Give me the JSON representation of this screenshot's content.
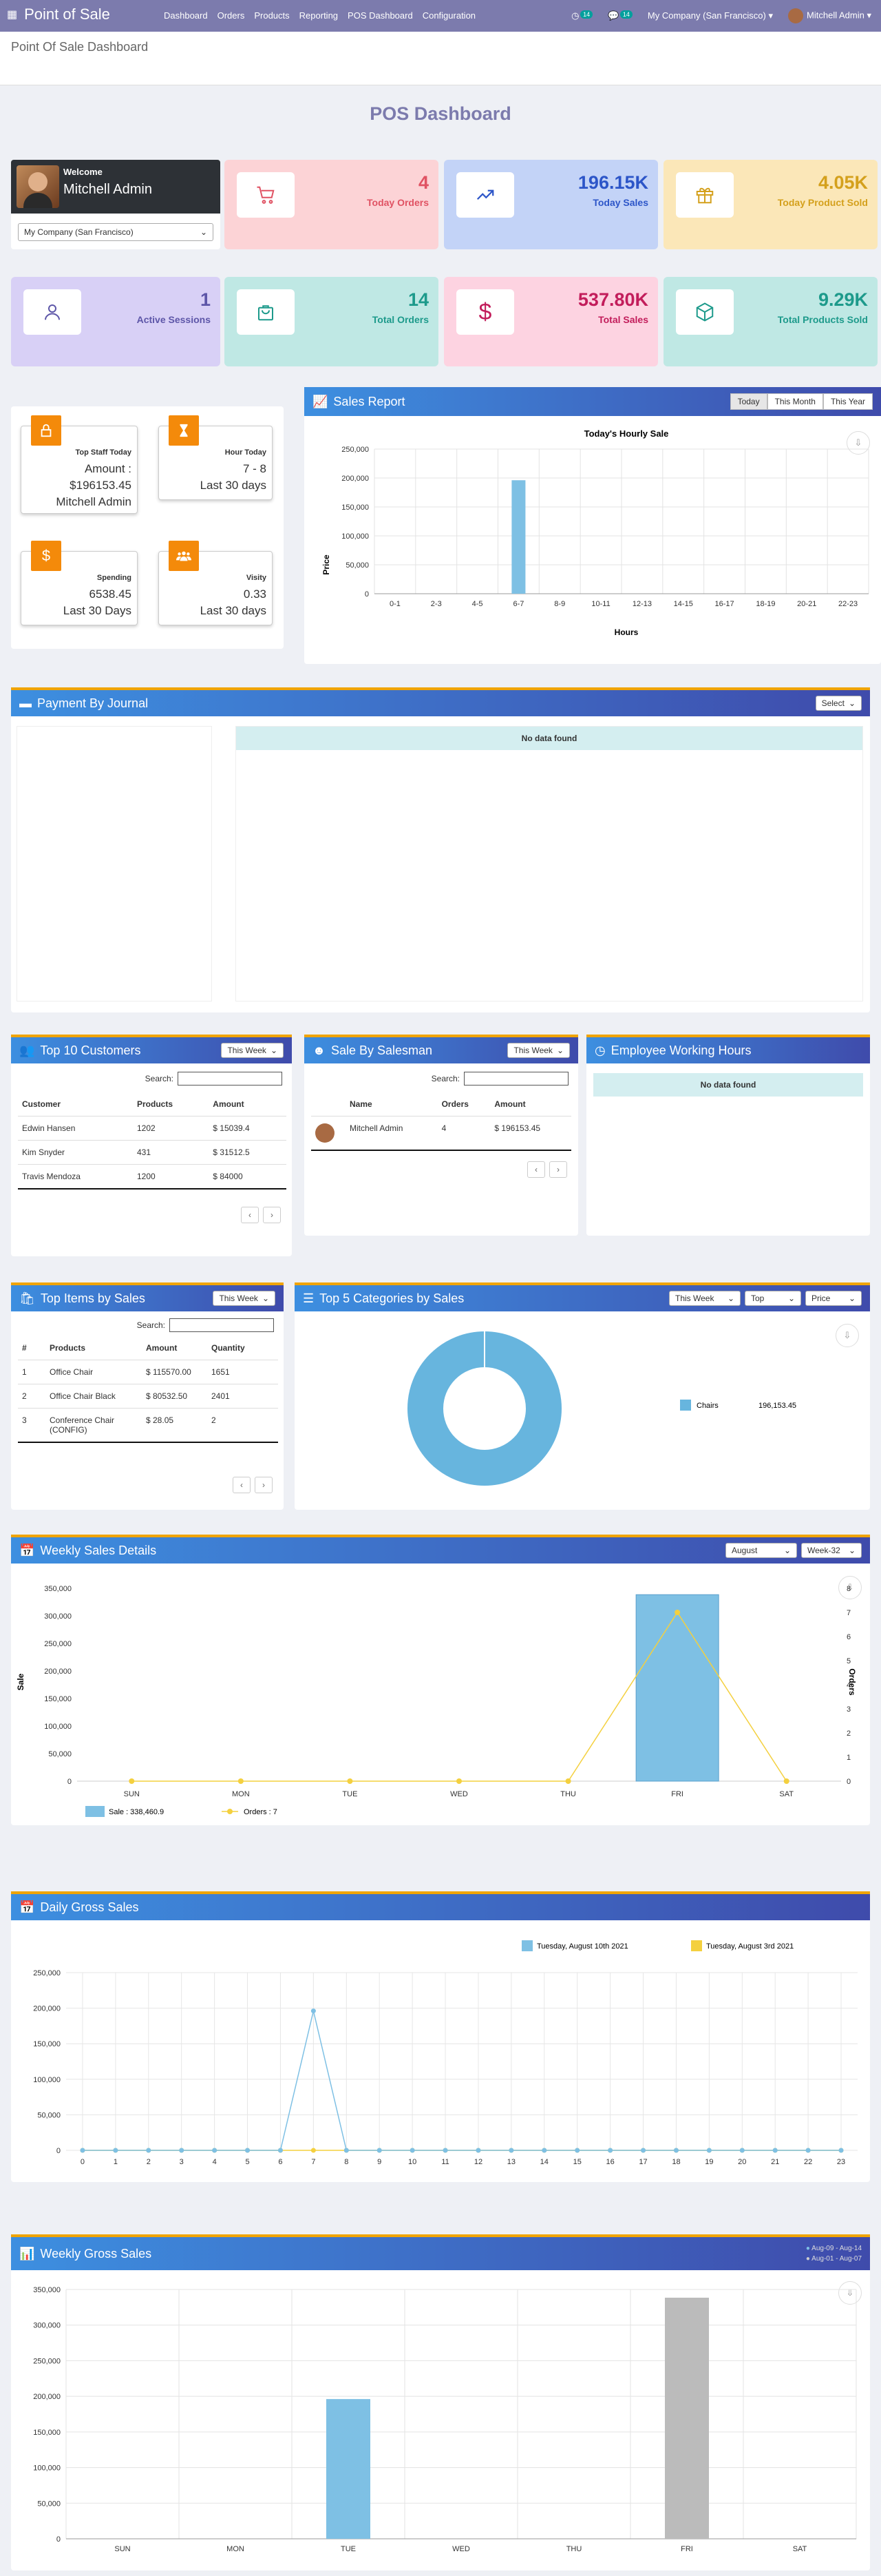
{
  "nav": {
    "brand": "Point of Sale",
    "menu": [
      "Dashboard",
      "Orders",
      "Products",
      "Reporting",
      "POS Dashboard",
      "Configuration"
    ],
    "activity_count": "14",
    "message_count": "14",
    "company": "My Company (San Francisco)",
    "user": "Mitchell Admin"
  },
  "breadcrumb": "Point Of Sale Dashboard",
  "dashboard_title": "POS Dashboard",
  "welcome": {
    "greeting": "Welcome",
    "name": "Mitchell Admin",
    "company_select": "My Company (San Francisco)"
  },
  "kpis": [
    {
      "value": "4",
      "label": "Today Orders",
      "bg": "#fcd3d6",
      "color": "#e05263",
      "icon": "cart-icon"
    },
    {
      "value": "196.15K",
      "label": "Today Sales",
      "bg": "#c3d3f7",
      "color": "#2c55c8",
      "icon": "trend-up-icon"
    },
    {
      "value": "4.05K",
      "label": "Today Product Sold",
      "bg": "#fbe7b8",
      "color": "#d4a01c",
      "icon": "gift-icon"
    },
    {
      "value": "1",
      "label": "Active Sessions",
      "bg": "#d8d0f6",
      "color": "#5d56a8",
      "icon": "user-icon"
    },
    {
      "value": "14",
      "label": "Total Orders",
      "bg": "#bfe8e4",
      "color": "#1d9a8b",
      "icon": "bag-icon"
    },
    {
      "value": "537.80K",
      "label": "Total Sales",
      "bg": "#fdd3e1",
      "color": "#c21d5b",
      "icon": "dollar-icon"
    },
    {
      "value": "9.29K",
      "label": "Total Products Sold",
      "bg": "#bfe8e4",
      "color": "#1d9a8b",
      "icon": "box-icon"
    }
  ],
  "stats": {
    "top_staff": {
      "title": "Top Staff Today",
      "line1": "Amount :",
      "line2": "$196153.45",
      "line3": "Mitchell Admin"
    },
    "hour_today": {
      "title": "Hour Today",
      "line1": "7 - 8",
      "line2": "Last 30 days"
    },
    "spending": {
      "title": "Spending",
      "line1": "6538.45",
      "line2": "Last 30 Days"
    },
    "visity": {
      "title": "Visity",
      "line1": "0.33",
      "line2": "Last 30 days"
    }
  },
  "sales_report": {
    "title": "Sales Report",
    "tabs": [
      "Today",
      "This Month",
      "This Year"
    ]
  },
  "chart_data": [
    {
      "id": "hourly",
      "type": "bar",
      "title": "Today's Hourly Sale",
      "xlabel": "Hours",
      "ylabel": "Price",
      "categories": [
        "0-1",
        "2-3",
        "4-5",
        "6-7",
        "8-9",
        "10-11",
        "12-13",
        "14-15",
        "16-17",
        "18-19",
        "20-21",
        "22-23"
      ],
      "values": [
        0,
        0,
        0,
        196153.45,
        0,
        0,
        0,
        0,
        0,
        0,
        0,
        0
      ],
      "ylim": [
        0,
        250000
      ],
      "yticks": [
        "0",
        "50,000",
        "100,000",
        "150,000",
        "200,000",
        "250,000"
      ],
      "color": "#7ec0e4"
    },
    {
      "id": "categories",
      "type": "pie",
      "labels": [
        "Chairs"
      ],
      "values": [
        196153.45
      ],
      "value_labels": [
        "196,153.45"
      ],
      "color": "#67b5de"
    },
    {
      "id": "weekly_details",
      "type": "bar",
      "categories": [
        "SUN",
        "MON",
        "TUE",
        "WED",
        "THU",
        "FRI",
        "SAT"
      ],
      "series": [
        {
          "name": "Sale",
          "legend": "Sale : 338,460.9",
          "values": [
            0,
            0,
            0,
            0,
            0,
            338460.9,
            0
          ],
          "color": "#7ec0e4"
        },
        {
          "name": "Orders",
          "legend": "Orders : 7",
          "values": [
            0,
            0,
            0,
            0,
            0,
            7,
            0
          ],
          "color": "#f4d03f"
        }
      ],
      "ylabel": "Sale",
      "y2label": "Orders",
      "ylim": [
        0,
        350000
      ],
      "y2lim": [
        0,
        8
      ],
      "yticks": [
        "0",
        "50,000",
        "100,000",
        "150,000",
        "200,000",
        "250,000",
        "300,000",
        "350,000"
      ],
      "y2ticks": [
        "0",
        "1",
        "2",
        "3",
        "4",
        "5",
        "6",
        "7",
        "8"
      ]
    },
    {
      "id": "daily_gross",
      "type": "line",
      "categories": [
        "0",
        "1",
        "2",
        "3",
        "4",
        "5",
        "6",
        "7",
        "8",
        "9",
        "10",
        "11",
        "12",
        "13",
        "14",
        "15",
        "16",
        "17",
        "18",
        "19",
        "20",
        "21",
        "22",
        "23"
      ],
      "series": [
        {
          "name": "Tuesday, August 10th 2021",
          "values": [
            0,
            0,
            0,
            0,
            0,
            0,
            0,
            196153.45,
            0,
            0,
            0,
            0,
            0,
            0,
            0,
            0,
            0,
            0,
            0,
            0,
            0,
            0,
            0,
            0
          ],
          "color": "#7ec0e4"
        },
        {
          "name": "Tuesday, August 3rd 2021",
          "values": [
            0,
            0,
            0,
            0,
            0,
            0,
            0,
            0,
            0,
            0,
            0,
            0,
            0,
            0,
            0,
            0,
            0,
            0,
            0,
            0,
            0,
            0,
            0,
            0
          ],
          "color": "#f4d03f"
        }
      ],
      "ylim": [
        0,
        250000
      ],
      "yticks": [
        "0",
        "50,000",
        "100,000",
        "150,000",
        "200,000",
        "250,000"
      ]
    },
    {
      "id": "weekly_gross",
      "type": "bar",
      "categories": [
        "SUN",
        "MON",
        "TUE",
        "WED",
        "THU",
        "FRI",
        "SAT"
      ],
      "series": [
        {
          "name": "Aug-09 - Aug-14",
          "values": [
            0,
            0,
            196153.45,
            0,
            0,
            0,
            0
          ],
          "color": "#7ec0e4"
        },
        {
          "name": "Aug-01 - Aug-07",
          "values": [
            0,
            0,
            0,
            0,
            0,
            338460.9,
            0
          ],
          "color": "#bbbbbb"
        }
      ],
      "ylim": [
        0,
        350000
      ],
      "yticks": [
        "0",
        "50,000",
        "100,000",
        "150,000",
        "200,000",
        "250,000",
        "300,000",
        "350,000"
      ]
    }
  ],
  "payment": {
    "title": "Payment By Journal",
    "select": "Select",
    "nodata": "No data found"
  },
  "top_customers": {
    "title": "Top 10 Customers",
    "filter": "This Week",
    "search": "Search:",
    "columns": [
      "Customer",
      "Products",
      "Amount"
    ],
    "rows": [
      [
        "Edwin Hansen",
        "1202",
        "$ 15039.4"
      ],
      [
        "Kim Snyder",
        "431",
        "$ 31512.5"
      ],
      [
        "Travis Mendoza",
        "1200",
        "$ 84000"
      ]
    ]
  },
  "salesman": {
    "title": "Sale By Salesman",
    "filter": "This Week",
    "search": "Search:",
    "columns": [
      "Name",
      "Orders",
      "Amount"
    ],
    "rows": [
      [
        "Mitchell Admin",
        "4",
        "$ 196153.45"
      ]
    ]
  },
  "employee_hours": {
    "title": "Employee Working Hours",
    "nodata": "No data found"
  },
  "top_items": {
    "title": "Top Items by Sales",
    "filter": "This Week",
    "search": "Search:",
    "columns": [
      "#",
      "Products",
      "Amount",
      "Quantity"
    ],
    "rows": [
      [
        "1",
        "Office Chair",
        "$ 115570.00",
        "1651"
      ],
      [
        "2",
        "Office Chair Black",
        "$ 80532.50",
        "2401"
      ],
      [
        "3",
        "Conference Chair (CONFIG)",
        "$ 28.05",
        "2"
      ]
    ]
  },
  "top_categories": {
    "title": "Top 5 Categories by Sales",
    "filters": [
      "This Week",
      "Top",
      "Price"
    ]
  },
  "weekly_details": {
    "title": "Weekly Sales Details",
    "filters": [
      "August",
      "Week-32"
    ]
  },
  "daily_gross": {
    "title": "Daily Gross Sales"
  },
  "weekly_gross": {
    "title": "Weekly Gross Sales"
  }
}
